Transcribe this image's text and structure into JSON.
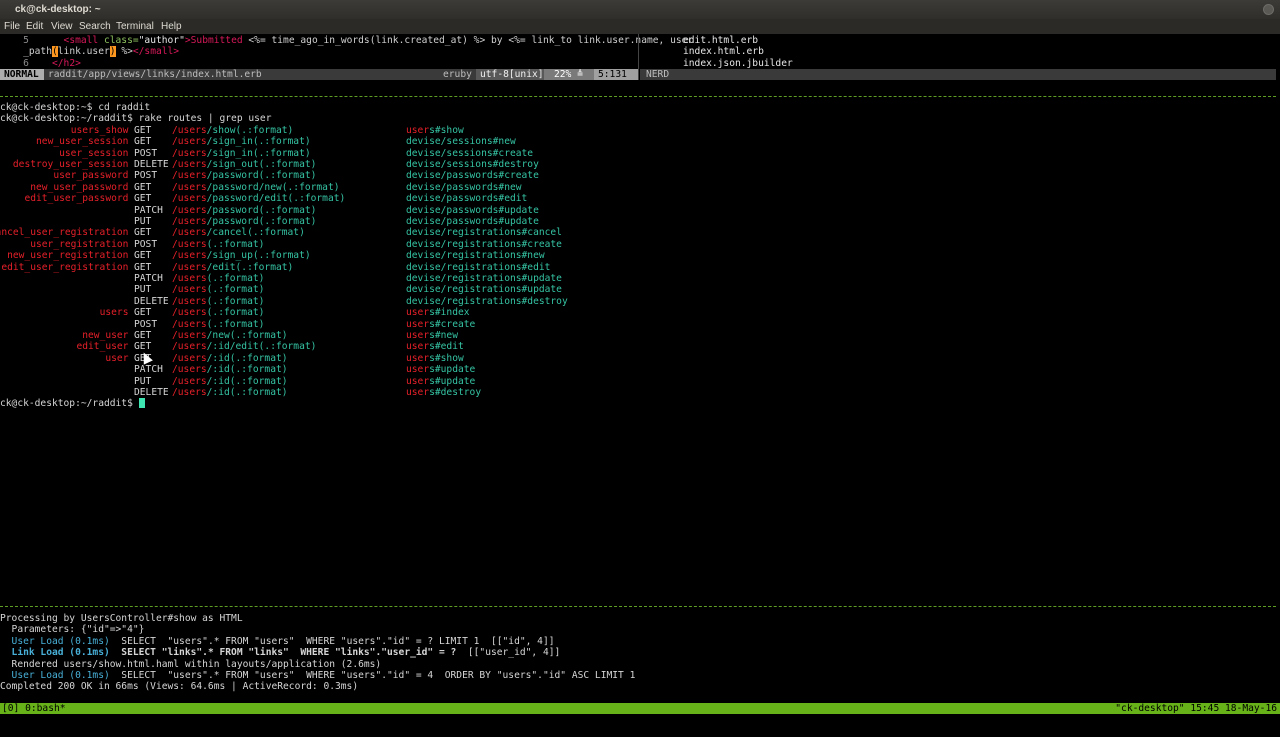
{
  "window": {
    "title": "ck@ck-desktop: ~"
  },
  "menu": [
    "File",
    "Edit",
    "View",
    "Search",
    "Terminal",
    "Help"
  ],
  "vim": {
    "line5_num": "5",
    "line5": {
      "indent": "      ",
      "tag_open": "<small",
      "attr": " class=",
      "str": "\"author\"",
      "gt": ">",
      "submitted": "Submitted ",
      "erb1": "<%=",
      "code1": " time_ago_in_words(link.created_at) ",
      "erb1_close": "%>",
      "by": " by ",
      "erb2": "<%=",
      "code2": " link_to link.user.name, user"
    },
    "line5_wrap": {
      "code": "_path",
      "cursor": "(",
      "code_b": "link.user",
      "cursor2": ")",
      "erb_close": " %>",
      "tag_close": "</small>"
    },
    "line6_num": "6",
    "line6": "    </h2>",
    "status": {
      "mode": "NORMAL",
      "path": "raddit/app/views/links/index.html.erb",
      "filetype": "eruby",
      "encoding": "utf-8[unix]",
      "percent": "22% ≜",
      "position": "5:131"
    },
    "nerd_label": "NERD",
    "files": [
      "edit.html.erb",
      "index.html.erb",
      "index.json.jbuilder"
    ]
  },
  "shell": {
    "cmd1": "ck@ck-desktop:~$ cd raddit",
    "cmd2": "ck@ck-desktop:~/raddit$ rake routes | grep user",
    "routes": [
      {
        "pre": "",
        "hl": "user",
        "post": "s_show",
        "verb": "GET",
        "path": "/show(.:format)",
        "act_hl": "user",
        "act": "s#show"
      },
      {
        "pre": "new_",
        "hl": "user",
        "post": "_session",
        "verb": "GET",
        "path": "/sign_in(.:format)",
        "act_hl": "",
        "act": "devise/sessions#new"
      },
      {
        "pre": "",
        "hl": "user",
        "post": "_session",
        "verb": "POST",
        "path": "/sign_in(.:format)",
        "act_hl": "",
        "act": "devise/sessions#create"
      },
      {
        "pre": "destroy_",
        "hl": "user",
        "post": "_session",
        "verb": "DELETE",
        "path": "/sign_out(.:format)",
        "act_hl": "",
        "act": "devise/sessions#destroy"
      },
      {
        "pre": "",
        "hl": "user",
        "post": "_password",
        "verb": "POST",
        "path": "/password(.:format)",
        "act_hl": "",
        "act": "devise/passwords#create"
      },
      {
        "pre": "new_",
        "hl": "user",
        "post": "_password",
        "verb": "GET",
        "path": "/password/new(.:format)",
        "act_hl": "",
        "act": "devise/passwords#new"
      },
      {
        "pre": "edit_",
        "hl": "user",
        "post": "_password",
        "verb": "GET",
        "path": "/password/edit(.:format)",
        "act_hl": "",
        "act": "devise/passwords#edit"
      },
      {
        "pre": "",
        "hl": "",
        "post": "",
        "verb": "PATCH",
        "path": "/password(.:format)",
        "act_hl": "",
        "act": "devise/passwords#update"
      },
      {
        "pre": "",
        "hl": "",
        "post": "",
        "verb": "PUT",
        "path": "/password(.:format)",
        "act_hl": "",
        "act": "devise/passwords#update"
      },
      {
        "pre": "cancel_",
        "hl": "user",
        "post": "_registration",
        "verb": "GET",
        "path": "/cancel(.:format)",
        "act_hl": "",
        "act": "devise/registrations#cancel"
      },
      {
        "pre": "",
        "hl": "user",
        "post": "_registration",
        "verb": "POST",
        "path": "(.:format)",
        "act_hl": "",
        "act": "devise/registrations#create"
      },
      {
        "pre": "new_",
        "hl": "user",
        "post": "_registration",
        "verb": "GET",
        "path": "/sign_up(.:format)",
        "act_hl": "",
        "act": "devise/registrations#new"
      },
      {
        "pre": "edit_",
        "hl": "user",
        "post": "_registration",
        "verb": "GET",
        "path": "/edit(.:format)",
        "act_hl": "",
        "act": "devise/registrations#edit"
      },
      {
        "pre": "",
        "hl": "",
        "post": "",
        "verb": "PATCH",
        "path": "(.:format)",
        "act_hl": "",
        "act": "devise/registrations#update"
      },
      {
        "pre": "",
        "hl": "",
        "post": "",
        "verb": "PUT",
        "path": "(.:format)",
        "act_hl": "",
        "act": "devise/registrations#update"
      },
      {
        "pre": "",
        "hl": "",
        "post": "",
        "verb": "DELETE",
        "path": "(.:format)",
        "act_hl": "",
        "act": "devise/registrations#destroy"
      },
      {
        "pre": "",
        "hl": "user",
        "post": "s",
        "verb": "GET",
        "path": "(.:format)",
        "act_hl": "user",
        "act": "s#index"
      },
      {
        "pre": "",
        "hl": "",
        "post": "",
        "verb": "POST",
        "path": "(.:format)",
        "act_hl": "user",
        "act": "s#create"
      },
      {
        "pre": "new_",
        "hl": "user",
        "post": "",
        "verb": "GET",
        "path": "/new(.:format)",
        "act_hl": "user",
        "act": "s#new"
      },
      {
        "pre": "edit_",
        "hl": "user",
        "post": "",
        "verb": "GET",
        "path": "/:id/edit(.:format)",
        "act_hl": "user",
        "act": "s#edit"
      },
      {
        "pre": "",
        "hl": "user",
        "post": "",
        "verb": "GET",
        "path": "/:id(.:format)",
        "act_hl": "user",
        "act": "s#show"
      },
      {
        "pre": "",
        "hl": "",
        "post": "",
        "verb": "PATCH",
        "path": "/:id(.:format)",
        "act_hl": "user",
        "act": "s#update"
      },
      {
        "pre": "",
        "hl": "",
        "post": "",
        "verb": "PUT",
        "path": "/:id(.:format)",
        "act_hl": "user",
        "act": "s#update"
      },
      {
        "pre": "",
        "hl": "",
        "post": "",
        "verb": "DELETE",
        "path": "/:id(.:format)",
        "act_hl": "user",
        "act": "s#destroy"
      }
    ],
    "path_prefix_hl": "/users",
    "prompt": "ck@ck-desktop:~/raddit$ "
  },
  "log": {
    "l1": "Processing by UsersController#show as HTML",
    "l2": "  Parameters: {\"id\"=>\"4\"}",
    "l3a": "  User Load (0.1ms)",
    "l3b": "  SELECT  \"users\".* FROM \"users\"  WHERE \"users\".\"id\" = ? LIMIT 1  [[\"id\", 4]]",
    "l4a": "  Link Load (0.1ms)",
    "l4b": "  SELECT \"links\".* FROM \"links\"  WHERE \"links\".\"user_id\" = ?",
    "l4c": "  [[\"user_id\", 4]]",
    "l5": "  Rendered users/show.html.haml within layouts/application (2.6ms)",
    "l6a": "  User Load (0.1ms)",
    "l6b": "  SELECT  \"users\".* FROM \"users\"  WHERE \"users\".\"id\" = 4  ORDER BY \"users\".\"id\" ASC LIMIT 1",
    "l7": "Completed 200 OK in 66ms (Views: 64.6ms | ActiveRecord: 0.3ms)"
  },
  "tmux": {
    "left": "[0] 0:bash*",
    "right": "\"ck-desktop\" 15:45 18-May-16"
  },
  "colors": {
    "tmux": "#66b218",
    "route_name": "#e5202a",
    "action": "#35c3a3",
    "cursor": "#3fe5b0"
  }
}
